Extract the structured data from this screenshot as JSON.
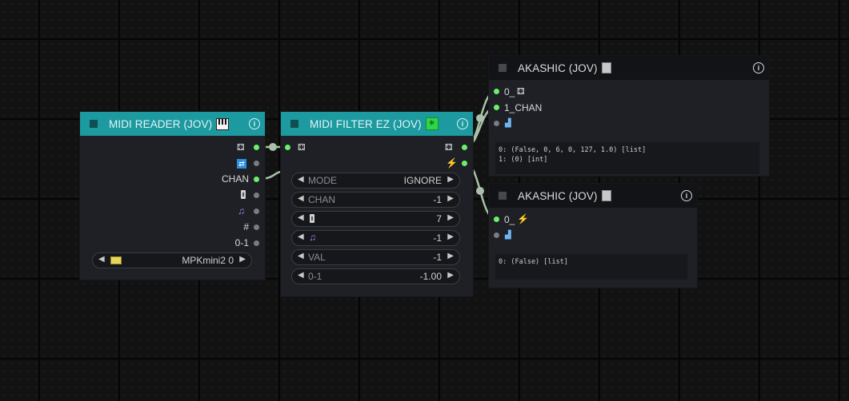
{
  "midi_reader": {
    "title": "MIDI READER (JOV)",
    "outputs": [
      "CHAN",
      "#",
      "0-1"
    ],
    "port_widget": {
      "value": "MPKmini2 0"
    }
  },
  "midi_filter": {
    "title": "MIDI FILTER EZ (JOV)",
    "widgets": [
      {
        "name": "MODE",
        "value": "IGNORE"
      },
      {
        "name": "CHAN",
        "value": "-1"
      },
      {
        "name": "",
        "icon": "slider-icon",
        "value": "7"
      },
      {
        "name": "",
        "icon": "music-icon",
        "value": "-1"
      },
      {
        "name": "VAL",
        "value": "-1"
      },
      {
        "name": "0-1",
        "value": "-1.00"
      }
    ]
  },
  "akashic_1": {
    "title": "AKASHIC (JOV)",
    "inputs": [
      "0_",
      "1_CHAN"
    ],
    "output_text_1": "0: (False, 0, 6, 0, 127, 1.0) [list]",
    "output_text_2": "1: (0) [int]"
  },
  "akashic_2": {
    "title": "AKASHIC (JOV)",
    "inputs": [
      "0_"
    ],
    "output_text_1": "0: (False) [list]"
  },
  "colors": {
    "teal_header": "#1c9aa0",
    "dark_header": "#121316",
    "slot_connected": "#6bf06b",
    "slot_empty": "#7c7c80",
    "link": "#a9c0a9"
  }
}
